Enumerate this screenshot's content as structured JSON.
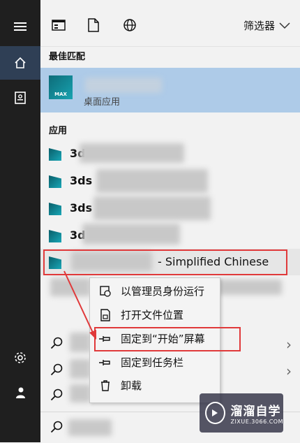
{
  "top": {
    "filter_label": "筛选器"
  },
  "sections": {
    "best_match": "最佳匹配",
    "apps": "应用"
  },
  "best_match": {
    "icon_text": "MAX",
    "subtitle": "桌面应用"
  },
  "apps": [
    {
      "label": "3d",
      "suffix": ""
    },
    {
      "label": "3ds",
      "suffix": ""
    },
    {
      "label": "3ds",
      "suffix": ""
    },
    {
      "label": "3d",
      "suffix": ""
    },
    {
      "label": "",
      "suffix": "- Simplified Chinese"
    }
  ],
  "context_menu": [
    {
      "label": "以管理员身份运行",
      "icon": "shield-run-icon"
    },
    {
      "label": "打开文件位置",
      "icon": "open-file-location-icon"
    },
    {
      "label": "固定到“开始”屏幕",
      "icon": "pin-icon"
    },
    {
      "label": "固定到任务栏",
      "icon": "pin-icon"
    },
    {
      "label": "卸载",
      "icon": "trash-icon"
    }
  ],
  "watermark": {
    "main": "溜溜自学",
    "sub": "ZIXUE.3066.COM"
  },
  "colors": {
    "highlight": "#aecbe8",
    "annotation": "#e0393a",
    "sidebar": "#1f1f1f"
  }
}
